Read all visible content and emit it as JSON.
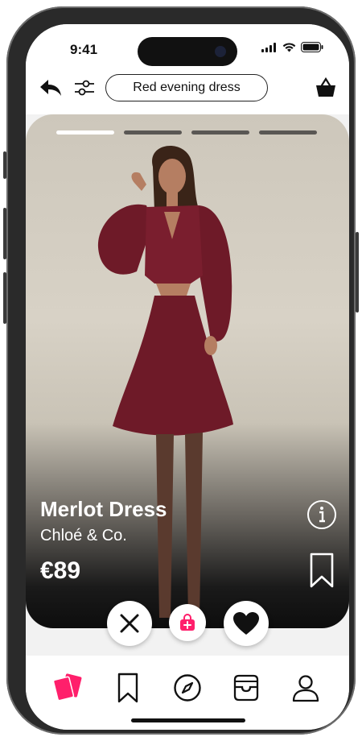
{
  "status": {
    "time": "9:41"
  },
  "search": {
    "query": "Red evening dress"
  },
  "product": {
    "name": "Merlot Dress",
    "brand": "Chloé & Co.",
    "price": "€89",
    "image_progress": {
      "total": 4,
      "active": 1
    }
  },
  "colors": {
    "accent": "#ff1f6b",
    "dress": "#6e1a28",
    "text_dark": "#111111"
  },
  "icons": {
    "back": "back-arrow-icon",
    "filter": "filter-sliders-icon",
    "basket": "basket-icon",
    "info": "info-icon",
    "bookmark": "bookmark-icon",
    "dislike": "close-icon",
    "add_to_bag": "shopping-bag-plus-icon",
    "like": "heart-icon"
  },
  "tabs": [
    {
      "name": "cards",
      "icon": "cards-icon",
      "active": true
    },
    {
      "name": "saved",
      "icon": "bookmark-icon",
      "active": false
    },
    {
      "name": "explore",
      "icon": "compass-icon",
      "active": false
    },
    {
      "name": "inbox",
      "icon": "inbox-icon",
      "active": false
    },
    {
      "name": "profile",
      "icon": "user-icon",
      "active": false
    }
  ]
}
